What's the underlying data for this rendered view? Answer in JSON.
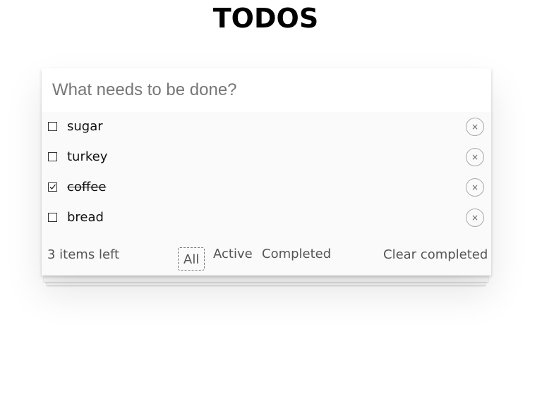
{
  "header": {
    "title": "TODOS"
  },
  "new_todo": {
    "placeholder": "What needs to be done?",
    "value": ""
  },
  "todos": [
    {
      "label": "sugar",
      "completed": false
    },
    {
      "label": "turkey",
      "completed": false
    },
    {
      "label": "coffee",
      "completed": true
    },
    {
      "label": "bread",
      "completed": false
    }
  ],
  "destroy_glyph": "×",
  "footer": {
    "count_text": "3 items left",
    "filters": [
      {
        "label": "All",
        "selected": true
      },
      {
        "label": "Active",
        "selected": false
      },
      {
        "label": "Completed",
        "selected": false
      }
    ],
    "clear_label": "Clear completed"
  }
}
